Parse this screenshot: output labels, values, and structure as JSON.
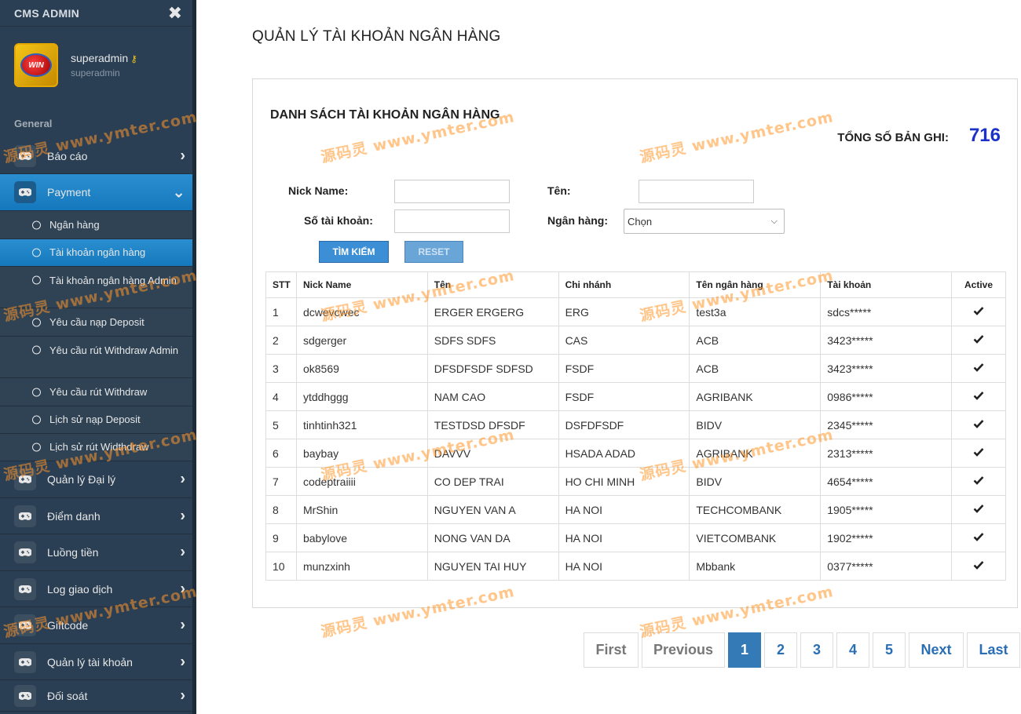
{
  "sidebar": {
    "brand": "CMS ADMIN",
    "close_glyph": "✖",
    "profile": {
      "name": "superadmin",
      "sub": "superadmin",
      "key_icon": "key-icon"
    },
    "section": "General",
    "items": [
      {
        "label": "Báo cáo",
        "icon": "gamepad-icon"
      },
      {
        "label": "Payment",
        "icon": "gamepad-icon",
        "active": true
      },
      {
        "label": "Quản lý Đại lý",
        "icon": "gamepad-icon"
      },
      {
        "label": "Điểm danh",
        "icon": "gamepad-icon"
      },
      {
        "label": "Luồng tiền",
        "icon": "gamepad-icon"
      },
      {
        "label": "Log giao dịch",
        "icon": "gamepad-icon"
      },
      {
        "label": "Giftcode",
        "icon": "gamepad-icon"
      },
      {
        "label": "Quản lý tài khoản",
        "icon": "gamepad-icon"
      },
      {
        "label": "Đối soát",
        "icon": "gamepad-icon"
      }
    ],
    "payment_sub": [
      {
        "label": "Ngân hàng"
      },
      {
        "label": "Tài khoản ngân hàng",
        "active": true
      },
      {
        "label": "Tài khoản ngân hàng Admin"
      },
      {
        "label": "Yêu cầu nạp Deposit"
      },
      {
        "label": "Yêu cầu rút Withdraw Admin"
      },
      {
        "label": "Yêu cầu rút Withdraw"
      },
      {
        "label": "Lịch sử nạp Deposit"
      },
      {
        "label": "Lịch sử rút Widthdraw"
      }
    ]
  },
  "page": {
    "title": "QUẢN LÝ TÀI KHOẢN NGÂN HÀNG",
    "panel_title": "DANH SÁCH TÀI KHOẢN NGÂN HÀNG",
    "total_label": "TỔNG SỐ BẢN GHI:",
    "total_value": "716"
  },
  "filters": {
    "nick_label": "Nick Name:",
    "nick_value": "",
    "ten_label": "Tên:",
    "ten_value": "",
    "account_label": "Số tài khoản:",
    "account_value": "",
    "bank_label": "Ngân hàng:",
    "bank_selected": "Chọn",
    "search_button": "TÌM KIẾM",
    "reset_button": "RESET"
  },
  "table": {
    "columns": [
      "STT",
      "Nick Name",
      "Tên",
      "Chi nhánh",
      "Tên ngân hàng",
      "Tài khoản",
      "Active"
    ],
    "rows": [
      {
        "stt": "1",
        "nick": "dcwevcwec",
        "ten": "ERGER ERGERG",
        "branch": "ERG",
        "bank": "test3a",
        "account": "sdcs*****",
        "active": true
      },
      {
        "stt": "2",
        "nick": "sdgerger",
        "ten": "SDFS SDFS",
        "branch": "CAS",
        "bank": "ACB",
        "account": "3423*****",
        "active": true
      },
      {
        "stt": "3",
        "nick": "ok8569",
        "ten": "DFSDFSDF SDFSD",
        "branch": "FSDF",
        "bank": "ACB",
        "account": "3423*****",
        "active": true
      },
      {
        "stt": "4",
        "nick": "ytddhggg",
        "ten": "NAM CAO",
        "branch": "FSDF",
        "bank": "AGRIBANK",
        "account": "0986*****",
        "active": true
      },
      {
        "stt": "5",
        "nick": "tinhtinh321",
        "ten": "TESTDSD DFSDF",
        "branch": "DSFDFSDF",
        "bank": "BIDV",
        "account": "2345*****",
        "active": true
      },
      {
        "stt": "6",
        "nick": "baybay",
        "ten": "DAVVV",
        "branch": "HSADA ADAD",
        "bank": "AGRIBANK",
        "account": "2313*****",
        "active": true
      },
      {
        "stt": "7",
        "nick": "codeptraiiii",
        "ten": "CO DEP TRAI",
        "branch": "HO CHI MINH",
        "bank": "BIDV",
        "account": "4654*****",
        "active": true
      },
      {
        "stt": "8",
        "nick": "MrShin",
        "ten": "NGUYEN VAN A",
        "branch": "HA NOI",
        "bank": "TECHCOMBANK",
        "account": "1905*****",
        "active": true
      },
      {
        "stt": "9",
        "nick": "babylove",
        "ten": "NONG VAN DA",
        "branch": "HA NOI",
        "bank": "VIETCOMBANK",
        "account": "1902*****",
        "active": true
      },
      {
        "stt": "10",
        "nick": "munzxinh",
        "ten": "NGUYEN TAI HUY",
        "branch": "HA NOI",
        "bank": "Mbbank",
        "account": "0377*****",
        "active": true
      }
    ]
  },
  "pagination": {
    "first": "First",
    "previous": "Previous",
    "pages": [
      "1",
      "2",
      "3",
      "4",
      "5"
    ],
    "current": "1",
    "next": "Next",
    "last": "Last"
  },
  "watermark": "源码灵 www.ymter.com",
  "colors": {
    "sidebar": "#2a3f54",
    "active": "#1e8fd6",
    "total": "#1b31c9",
    "pager_current": "#337ab7"
  }
}
